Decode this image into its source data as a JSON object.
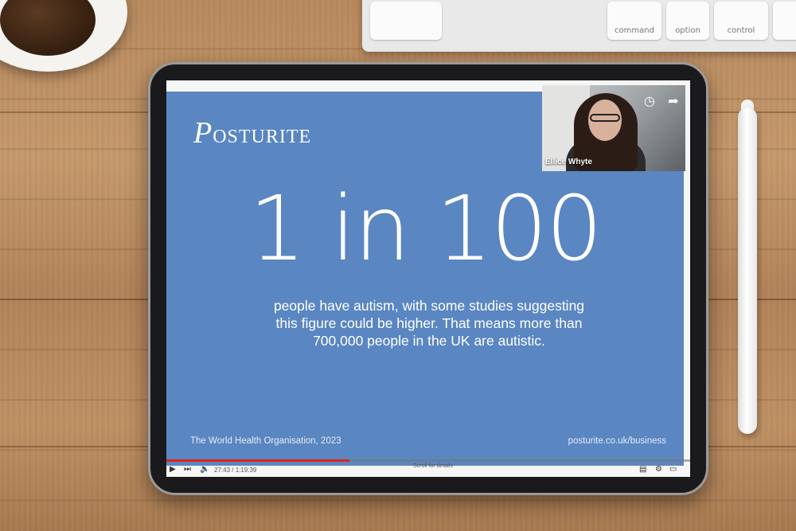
{
  "slide": {
    "logo_initial": "P",
    "logo_rest": "OSTURITE",
    "stat": "1 in 100",
    "description": "people have autism, with some studies suggesting this figure could be higher. That means more than 700,000 people in the UK are autistic.",
    "source": "The World Health Organisation, 2023",
    "url": "posturite.co.uk/business",
    "background_color": "#5a86c2"
  },
  "webcam": {
    "participant_name": "Ellice Whyte",
    "icons": [
      "clock-icon",
      "share-icon"
    ]
  },
  "player": {
    "time": "27:43 / 1:19:39",
    "scroll_hint": "Scroll for details",
    "progress_fraction": 0.35,
    "progress_color": "#e62117"
  },
  "keyboard": {
    "keys": [
      "command",
      "option",
      "control"
    ]
  }
}
